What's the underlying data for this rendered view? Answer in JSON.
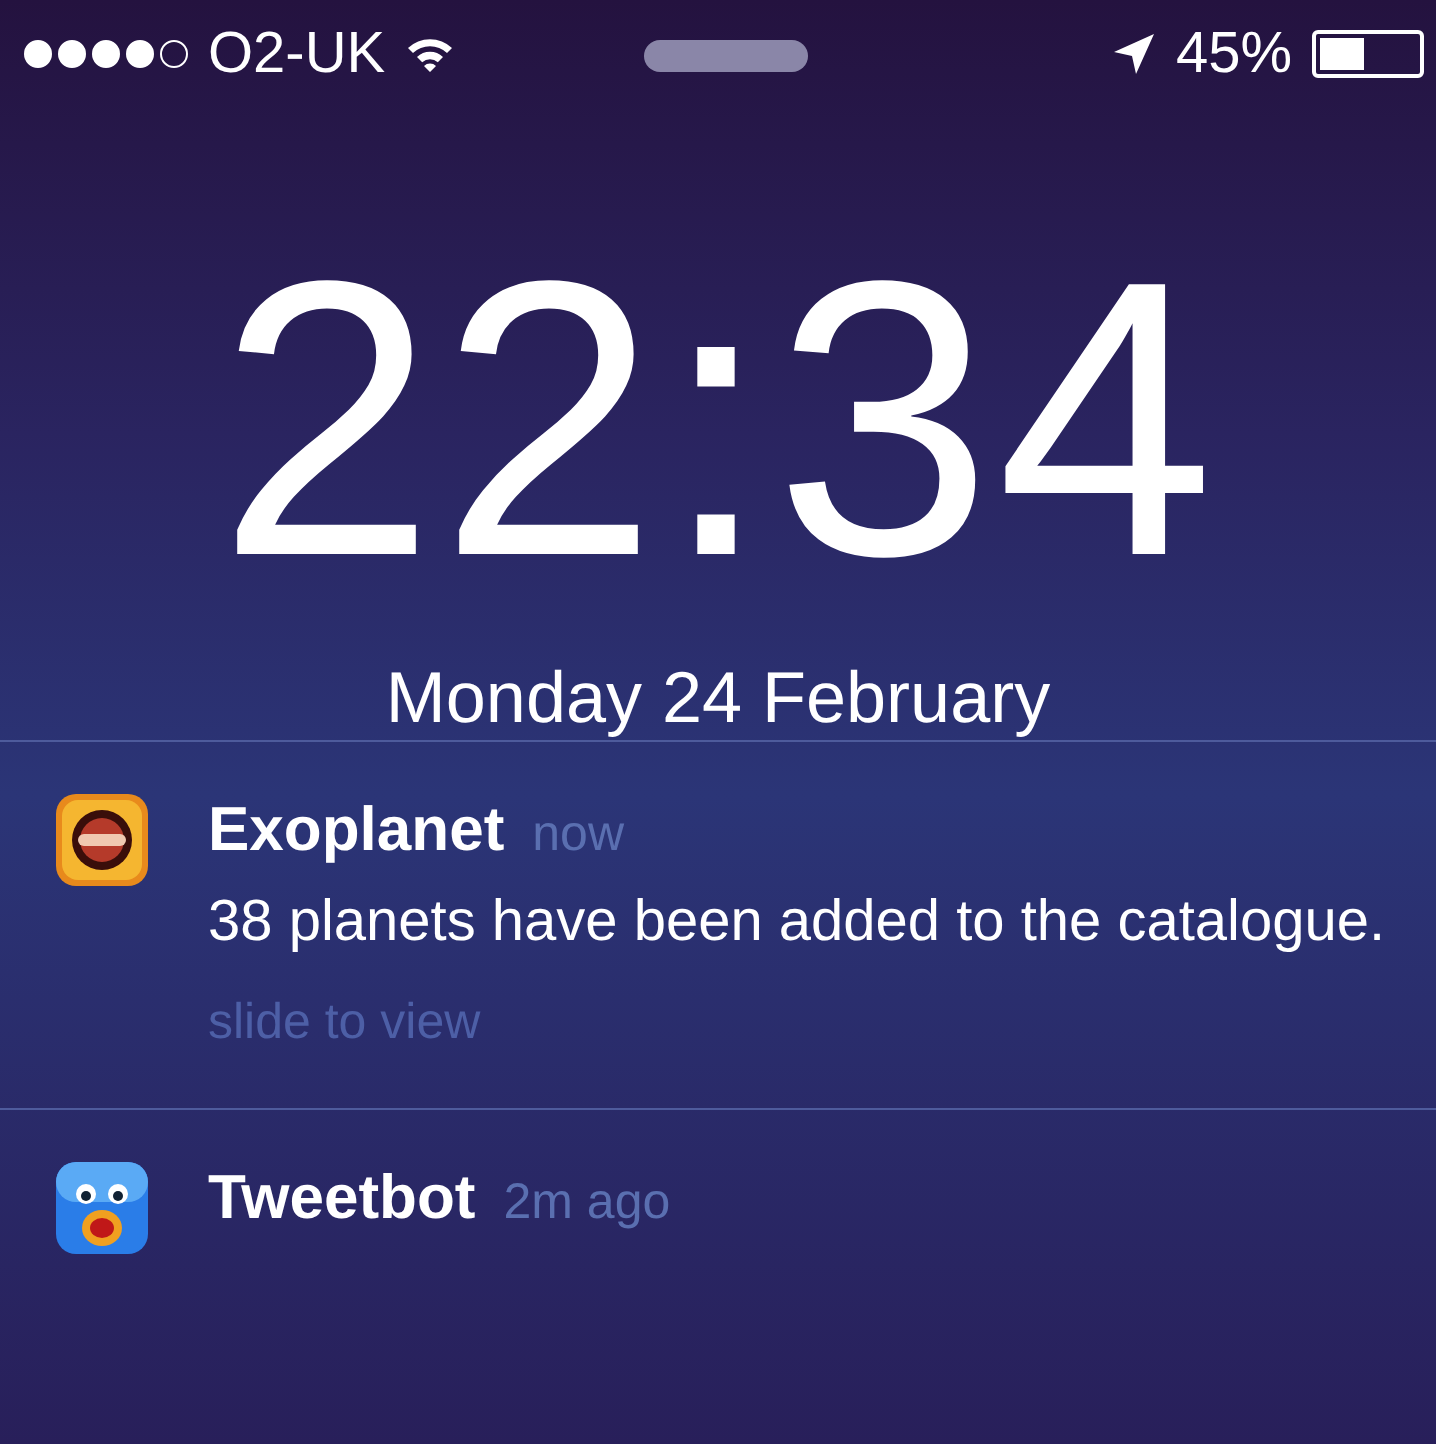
{
  "status_bar": {
    "carrier": "O2-UK",
    "battery_percent": "45%"
  },
  "clock": {
    "time": "22:34",
    "date": "Monday 24 February"
  },
  "notifications": [
    {
      "app": "Exoplanet",
      "time": "now",
      "message": "38 planets have been added to the catalogue.",
      "action_hint": "slide to view"
    },
    {
      "app": "Tweetbot",
      "time": "2m ago"
    }
  ]
}
